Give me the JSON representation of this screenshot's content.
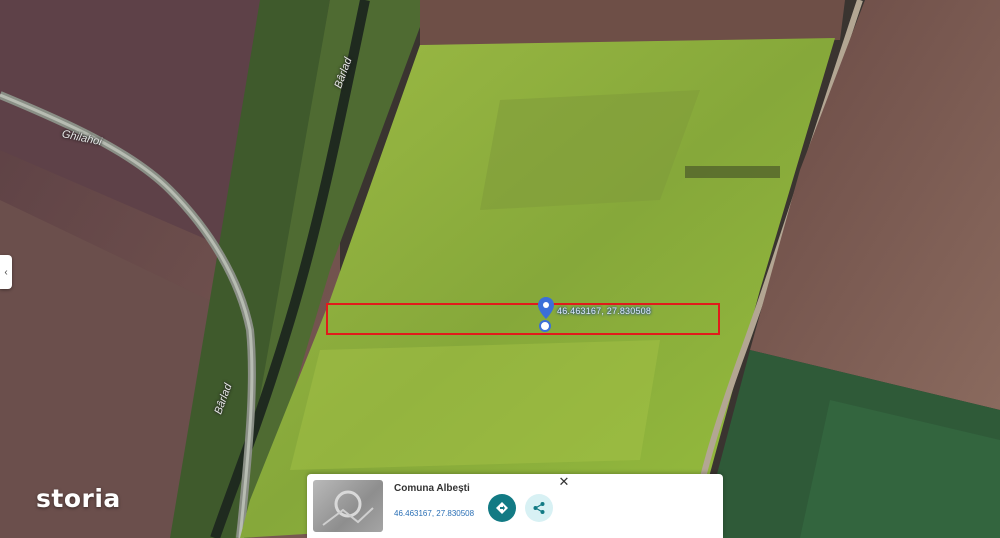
{
  "map": {
    "type": "satellite",
    "road_labels": [
      "Ghilahoi",
      "Bârlad",
      "Bârlad"
    ],
    "pin_coordinates_label": "46.463167, 27.830508",
    "highlight_color": "#e11b1b"
  },
  "brand": {
    "logo_text": "storia"
  },
  "info_card": {
    "place_name": "Comuna Albești",
    "coordinates": "46.463167, 27.830508",
    "directions_icon": "directions-icon",
    "share_icon": "share-icon",
    "close_label": "✕"
  },
  "colors": {
    "field_green": "#8fb23a",
    "plowed_brown": "#6e4f47",
    "accent_teal": "#127a84"
  }
}
